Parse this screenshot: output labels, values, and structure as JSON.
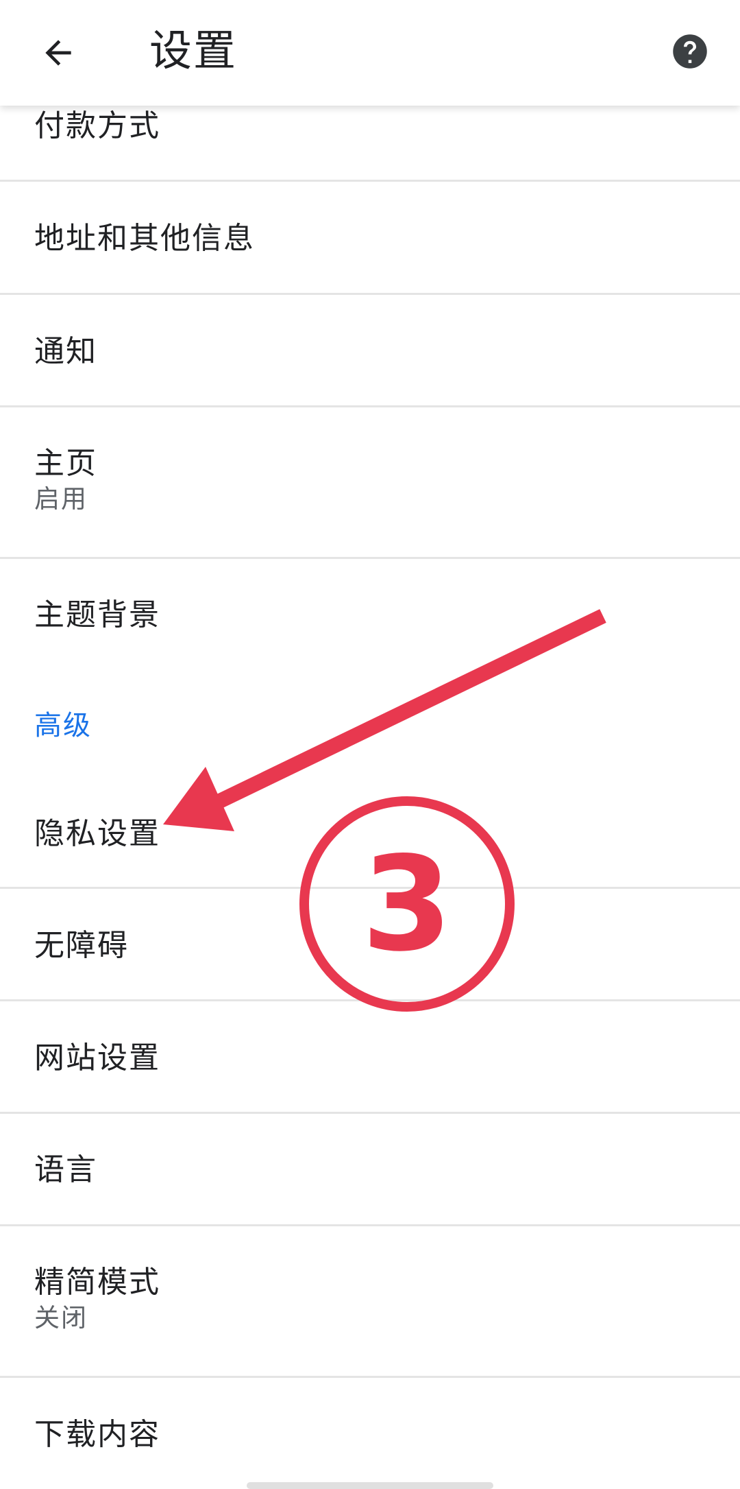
{
  "appbar": {
    "title": "设置",
    "back_icon": "arrow-left-icon",
    "help_icon": "help-circle-icon"
  },
  "settings": {
    "payment_methods": "付款方式",
    "addresses": "地址和其他信息",
    "notifications": "通知",
    "homepage": {
      "title": "主页",
      "subtitle": "启用"
    },
    "themes": "主题背景",
    "advanced_header": "高级",
    "privacy": "隐私设置",
    "accessibility": "无障碍",
    "site_settings": "网站设置",
    "languages": "语言",
    "lite_mode": {
      "title": "精简模式",
      "subtitle": "关闭"
    },
    "downloads": "下载内容"
  },
  "annotation": {
    "step_label": "3",
    "color": "#e8384f"
  },
  "colors": {
    "accent": "#1a73e8",
    "text_primary": "#202124",
    "text_secondary": "#5f6368",
    "divider": "#e4e4e4"
  }
}
